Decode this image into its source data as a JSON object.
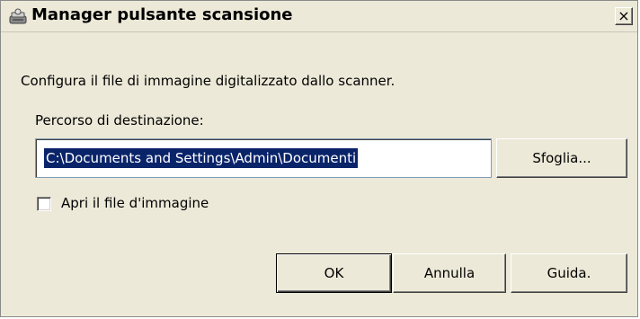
{
  "window": {
    "title": "Manager pulsante scansione",
    "close_label": "×"
  },
  "main": {
    "description": "Configura il file di immagine digitalizzato dallo scanner.",
    "path_label": "Percorso di destinazione:",
    "path_value": "C:\\Documents and Settings\\Admin\\Documenti",
    "browse_label": "Sfoglia...",
    "open_checkbox_label": "Apri il file d'immagine",
    "open_checkbox_checked": false
  },
  "buttons": {
    "ok_label": "OK",
    "cancel_label": "Annulla",
    "help_label": "Guida."
  },
  "icons": {
    "title_icon": "scanner-button-icon",
    "close_icon": "close-icon"
  },
  "colors": {
    "window_bg": "#ece9d8",
    "selection_bg": "#0a246a",
    "selection_text": "#ffffff"
  }
}
